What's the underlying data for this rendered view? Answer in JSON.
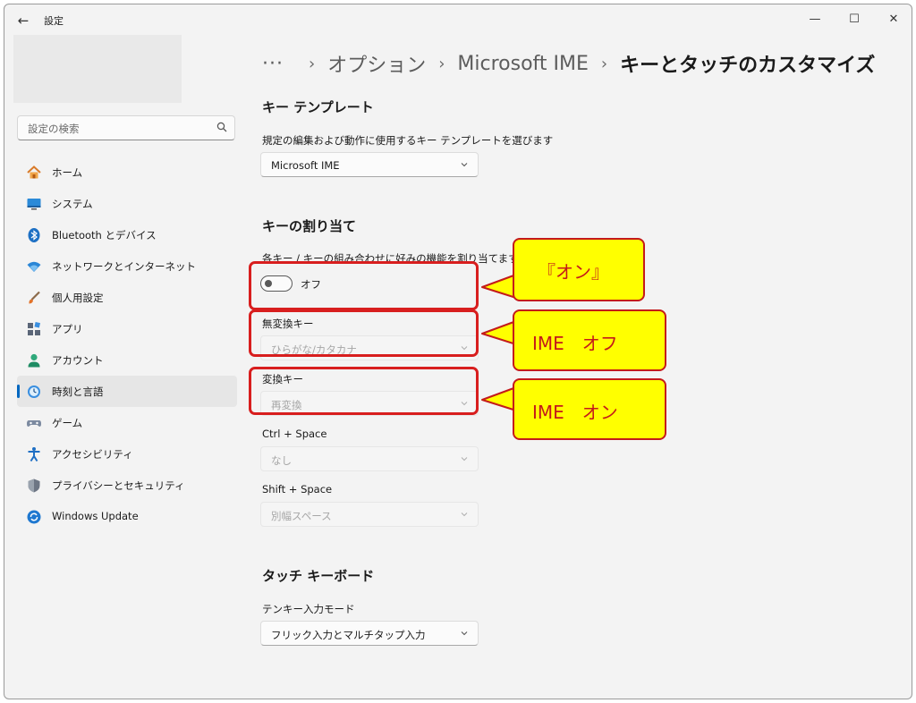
{
  "window": {
    "title": "設定",
    "back_glyph": "←",
    "minimize_glyph": "—",
    "maximize_glyph": "☐",
    "close_glyph": "✕"
  },
  "search": {
    "placeholder": "設定の検索",
    "icon": "search-icon"
  },
  "sidebar": {
    "items": [
      {
        "label": "ホーム",
        "icon": "home-icon",
        "active": false
      },
      {
        "label": "システム",
        "icon": "system-icon",
        "active": false
      },
      {
        "label": "Bluetooth とデバイス",
        "icon": "bluetooth-icon",
        "active": false
      },
      {
        "label": "ネットワークとインターネット",
        "icon": "wifi-icon",
        "active": false
      },
      {
        "label": "個人用設定",
        "icon": "brush-icon",
        "active": false
      },
      {
        "label": "アプリ",
        "icon": "apps-icon",
        "active": false
      },
      {
        "label": "アカウント",
        "icon": "account-icon",
        "active": false
      },
      {
        "label": "時刻と言語",
        "icon": "time-language-icon",
        "active": true
      },
      {
        "label": "ゲーム",
        "icon": "gamepad-icon",
        "active": false
      },
      {
        "label": "アクセシビリティ",
        "icon": "accessibility-icon",
        "active": false
      },
      {
        "label": "プライバシーとセキュリティ",
        "icon": "shield-icon",
        "active": false
      },
      {
        "label": "Windows Update",
        "icon": "windows-update-icon",
        "active": false
      }
    ]
  },
  "breadcrumb": {
    "overflow": "···",
    "separator": "›",
    "items": [
      "オプション",
      "Microsoft IME"
    ],
    "current": "キーとタッチのカスタマイズ"
  },
  "key_template": {
    "title": "キー テンプレート",
    "description": "規定の編集および動作に使用するキー テンプレートを選びます",
    "selected": "Microsoft IME"
  },
  "key_assign": {
    "title": "キーの割り当て",
    "description": "各キー / キーの組み合わせに好みの機能を割り当てます",
    "toggle_state": "オフ",
    "muhenkan": {
      "label": "無変換キー",
      "value": "ひらがな/カタカナ"
    },
    "henkan": {
      "label": "変換キー",
      "value": "再変換"
    },
    "ctrl_space": {
      "label": "Ctrl + Space",
      "value": "なし"
    },
    "shift_space": {
      "label": "Shift + Space",
      "value": "別幅スペース"
    }
  },
  "touch_keyboard": {
    "title": "タッチ キーボード",
    "tenkey_label": "テンキー入力モード",
    "tenkey_value": "フリック入力とマルチタップ入力"
  },
  "annotations": {
    "callout_toggle": "『オン』",
    "callout_muhenkan": "IME　オフ",
    "callout_henkan": "IME　オン",
    "highlight_color": "#d81e1e",
    "callout_fill": "#ffff00"
  },
  "colors": {
    "accent": "#0067c0",
    "window_bg": "#f3f3f3"
  }
}
